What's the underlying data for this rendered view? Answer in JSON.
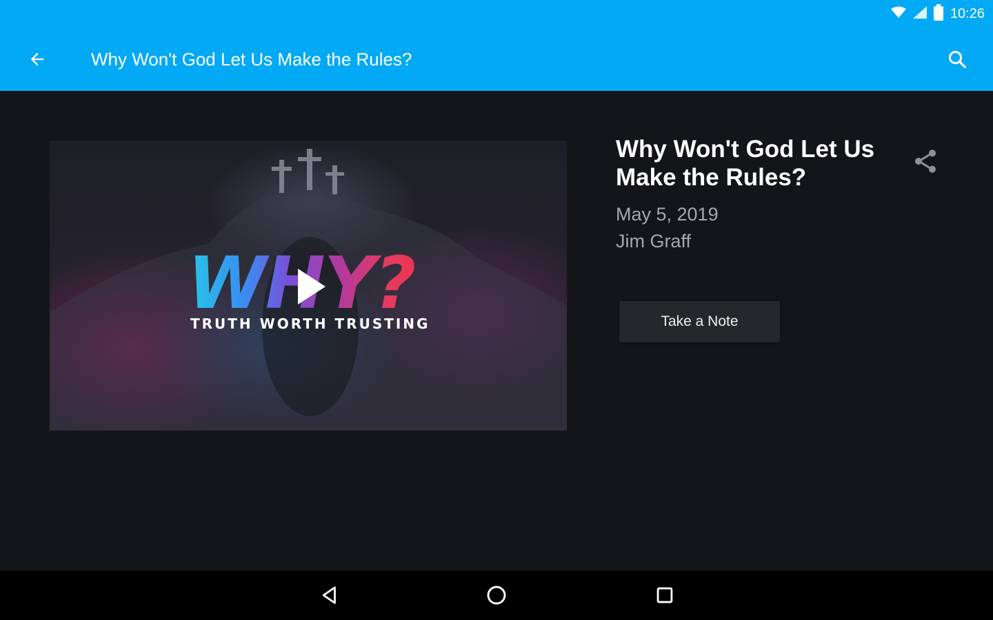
{
  "status_bar": {
    "time": "10:26",
    "icons": [
      "wifi-icon",
      "signal-icon",
      "battery-icon"
    ]
  },
  "app_bar": {
    "title": "Why Won't God Let Us Make the Rules?",
    "back_icon": "arrow-left-icon",
    "search_icon": "search-icon",
    "color": "#03A9F4"
  },
  "video": {
    "brand_title": "WHY?",
    "brand_subtitle": "TRUTH WORTH TRUSTING",
    "play_icon": "play-icon"
  },
  "sermon": {
    "title": "Why Won't God Let Us Make the Rules?",
    "date": "May 5, 2019",
    "speaker": "Jim Graff",
    "share_icon": "share-icon",
    "note_button_label": "Take a Note"
  },
  "nav_bar": {
    "icons": [
      "back-triangle-icon",
      "home-circle-icon",
      "recents-square-icon"
    ]
  },
  "colors": {
    "accent": "#03A9F4",
    "background": "#141518",
    "text_primary": "#FFFFFF",
    "text_secondary": "#A6A8AB",
    "button_bg": "#26272A"
  }
}
